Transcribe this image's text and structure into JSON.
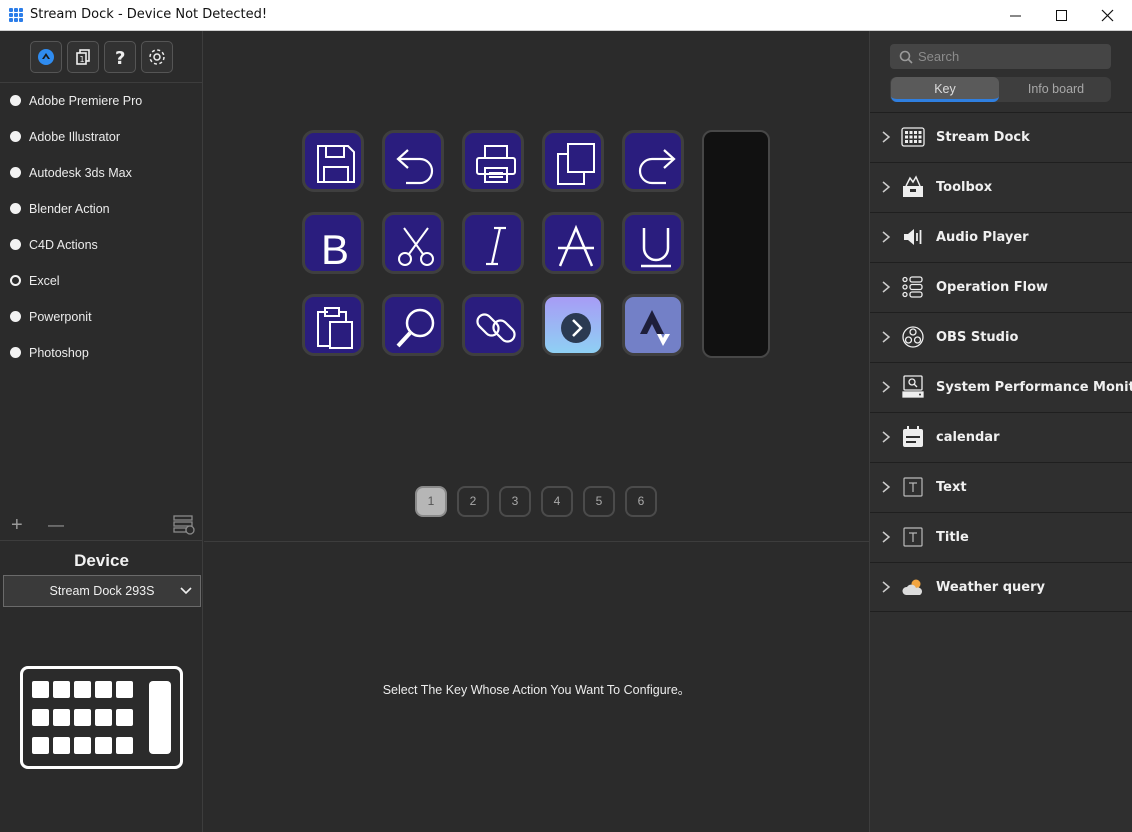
{
  "window": {
    "title": "Stream Dock - Device Not Detected!"
  },
  "profiles": [
    {
      "name": "Adobe Premiere Pro",
      "selected": false
    },
    {
      "name": "Adobe Illustrator",
      "selected": false
    },
    {
      "name": "Autodesk 3ds Max",
      "selected": false
    },
    {
      "name": "Blender  Action",
      "selected": false
    },
    {
      "name": "C4D Actions",
      "selected": false
    },
    {
      "name": "Excel",
      "selected": true
    },
    {
      "name": "Powerponit",
      "selected": false
    },
    {
      "name": "Photoshop",
      "selected": false
    }
  ],
  "profile_actions": {
    "add": "+",
    "remove": "—"
  },
  "device": {
    "label": "Device",
    "selected": "Stream Dock 293S"
  },
  "keys": [
    "save-icon",
    "undo-icon",
    "print-icon",
    "copy-icon",
    "redo-icon",
    "bold-icon",
    "cut-icon",
    "italic-icon",
    "strikethrough-icon",
    "underline-icon",
    "paste-icon",
    "search-icon",
    "link-icon",
    "arrow-right-circle-icon",
    "strava-icon"
  ],
  "pages": {
    "labels": [
      "1",
      "2",
      "3",
      "4",
      "5",
      "6"
    ],
    "active": "1"
  },
  "hint": "Select The Key Whose Action You Want To Configure。",
  "search": {
    "placeholder": "Search",
    "value": ""
  },
  "tabs": {
    "key": "Key",
    "info_board": "Info board",
    "active": "Key"
  },
  "categories": [
    {
      "label": "Stream Dock",
      "icon": "keypad-icon"
    },
    {
      "label": "Toolbox",
      "icon": "toolbox-icon"
    },
    {
      "label": "Audio Player",
      "icon": "speaker-icon"
    },
    {
      "label": "Operation Flow",
      "icon": "flow-icon"
    },
    {
      "label": "OBS Studio",
      "icon": "obs-icon"
    },
    {
      "label": "System Performance Monitor",
      "icon": "monitor-icon"
    },
    {
      "label": "calendar",
      "icon": "calendar-icon"
    },
    {
      "label": "Text",
      "icon": "text-icon"
    },
    {
      "label": "Title",
      "icon": "title-icon"
    },
    {
      "label": "Weather query",
      "icon": "weather-icon"
    }
  ],
  "colors": {
    "accent": "#2f7fe0",
    "key_background": "#2a1d7e"
  }
}
